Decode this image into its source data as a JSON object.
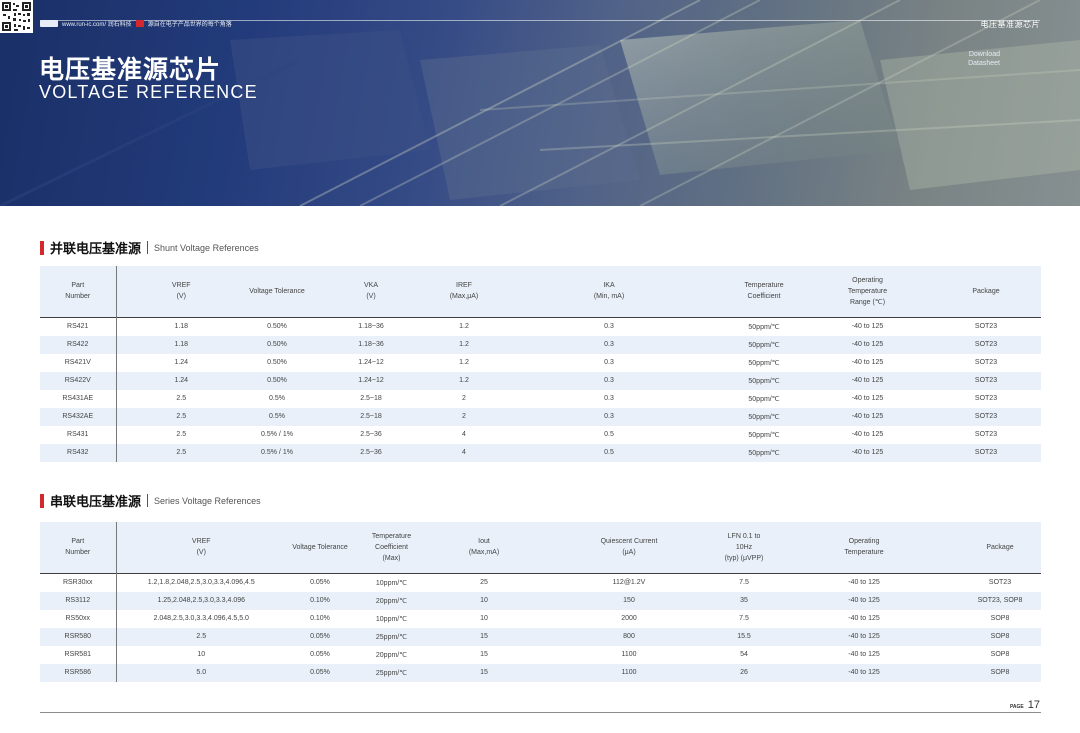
{
  "header": {
    "site": "www.run-ic.com/ 润石科技",
    "site_slogan": "源自在电子产品世界的每个角落",
    "category": "电压基准源芯片",
    "title_cn": "电压基准源芯片",
    "title_en": "VOLTAGE REFERENCE",
    "download_label": "Download Datasheet"
  },
  "shunt": {
    "heading_cn": "并联电压基准源",
    "heading_en": "Shunt Voltage References",
    "headers": [
      "Part\nNumber",
      "VREF\n(V)",
      "Voltage Tolerance",
      "VKA\n(V)",
      "IREF\n(Max,μA)",
      "IKA\n(Min, mA)",
      "Temperature\nCoefficient",
      "Operating\nTemperature\nRange (℃)",
      "Package"
    ],
    "rows": [
      [
        "RS421",
        "1.18",
        "0.50%",
        "1.18~36",
        "1.2",
        "0.3",
        "50ppm/℃",
        "-40 to 125",
        "SOT23"
      ],
      [
        "RS422",
        "1.18",
        "0.50%",
        "1.18~36",
        "1.2",
        "0.3",
        "50ppm/℃",
        "-40 to 125",
        "SOT23"
      ],
      [
        "RS421V",
        "1.24",
        "0.50%",
        "1.24~12",
        "1.2",
        "0.3",
        "50ppm/℃",
        "-40 to 125",
        "SOT23"
      ],
      [
        "RS422V",
        "1.24",
        "0.50%",
        "1.24~12",
        "1.2",
        "0.3",
        "50ppm/℃",
        "-40 to 125",
        "SOT23"
      ],
      [
        "RS431AE",
        "2.5",
        "0.5%",
        "2.5~18",
        "2",
        "0.3",
        "50ppm/℃",
        "-40 to 125",
        "SOT23"
      ],
      [
        "RS432AE",
        "2.5",
        "0.5%",
        "2.5~18",
        "2",
        "0.3",
        "50ppm/℃",
        "-40 to 125",
        "SOT23"
      ],
      [
        "RS431",
        "2.5",
        "0.5% / 1%",
        "2.5~36",
        "4",
        "0.5",
        "50ppm/℃",
        "-40 to 125",
        "SOT23"
      ],
      [
        "RS432",
        "2.5",
        "0.5% / 1%",
        "2.5~36",
        "4",
        "0.5",
        "50ppm/℃",
        "-40 to 125",
        "SOT23"
      ]
    ]
  },
  "series": {
    "heading_cn": "串联电压基准源",
    "heading_en": "Series Voltage References",
    "headers": [
      "Part\nNumber",
      "VREF\n(V)",
      "Voltage Tolerance",
      "Temperature\nCoefficient\n(Max)",
      "Iout\n(Max,mA)",
      "Quiescent Current\n(μA)",
      "LFN 0.1 to 10Hz\n(typ) (μVPP)",
      "Operating\nTemperature",
      "Package"
    ],
    "rows": [
      [
        "RSR30xx",
        "1.2,1.8,2.048,2.5,3.0,3.3,4.096,4.5",
        "0.05%",
        "10ppm/℃",
        "25",
        "112@1.2V",
        "7.5",
        "-40 to 125",
        "SOT23"
      ],
      [
        "RS3112",
        "1.25,2.048,2.5,3.0,3.3,4.096",
        "0.10%",
        "20ppm/℃",
        "10",
        "150",
        "35",
        "-40 to 125",
        "SOT23, SOP8"
      ],
      [
        "RS50xx",
        "2.048,2.5,3.0,3.3,4.096,4.5,5.0",
        "0.10%",
        "10ppm/℃",
        "10",
        "2000",
        "7.5",
        "-40 to 125",
        "SOP8"
      ],
      [
        "RSR580",
        "2.5",
        "0.05%",
        "25ppm/℃",
        "15",
        "800",
        "15.5",
        "-40 to 125",
        "SOP8"
      ],
      [
        "RSR581",
        "10",
        "0.05%",
        "20ppm/℃",
        "15",
        "1100",
        "54",
        "-40 to 125",
        "SOP8"
      ],
      [
        "RSR586",
        "5.0",
        "0.05%",
        "25ppm/℃",
        "15",
        "1100",
        "26",
        "-40 to 125",
        "SOP8"
      ]
    ]
  },
  "footer": {
    "page_label": "PAGE",
    "page_number": "17"
  }
}
